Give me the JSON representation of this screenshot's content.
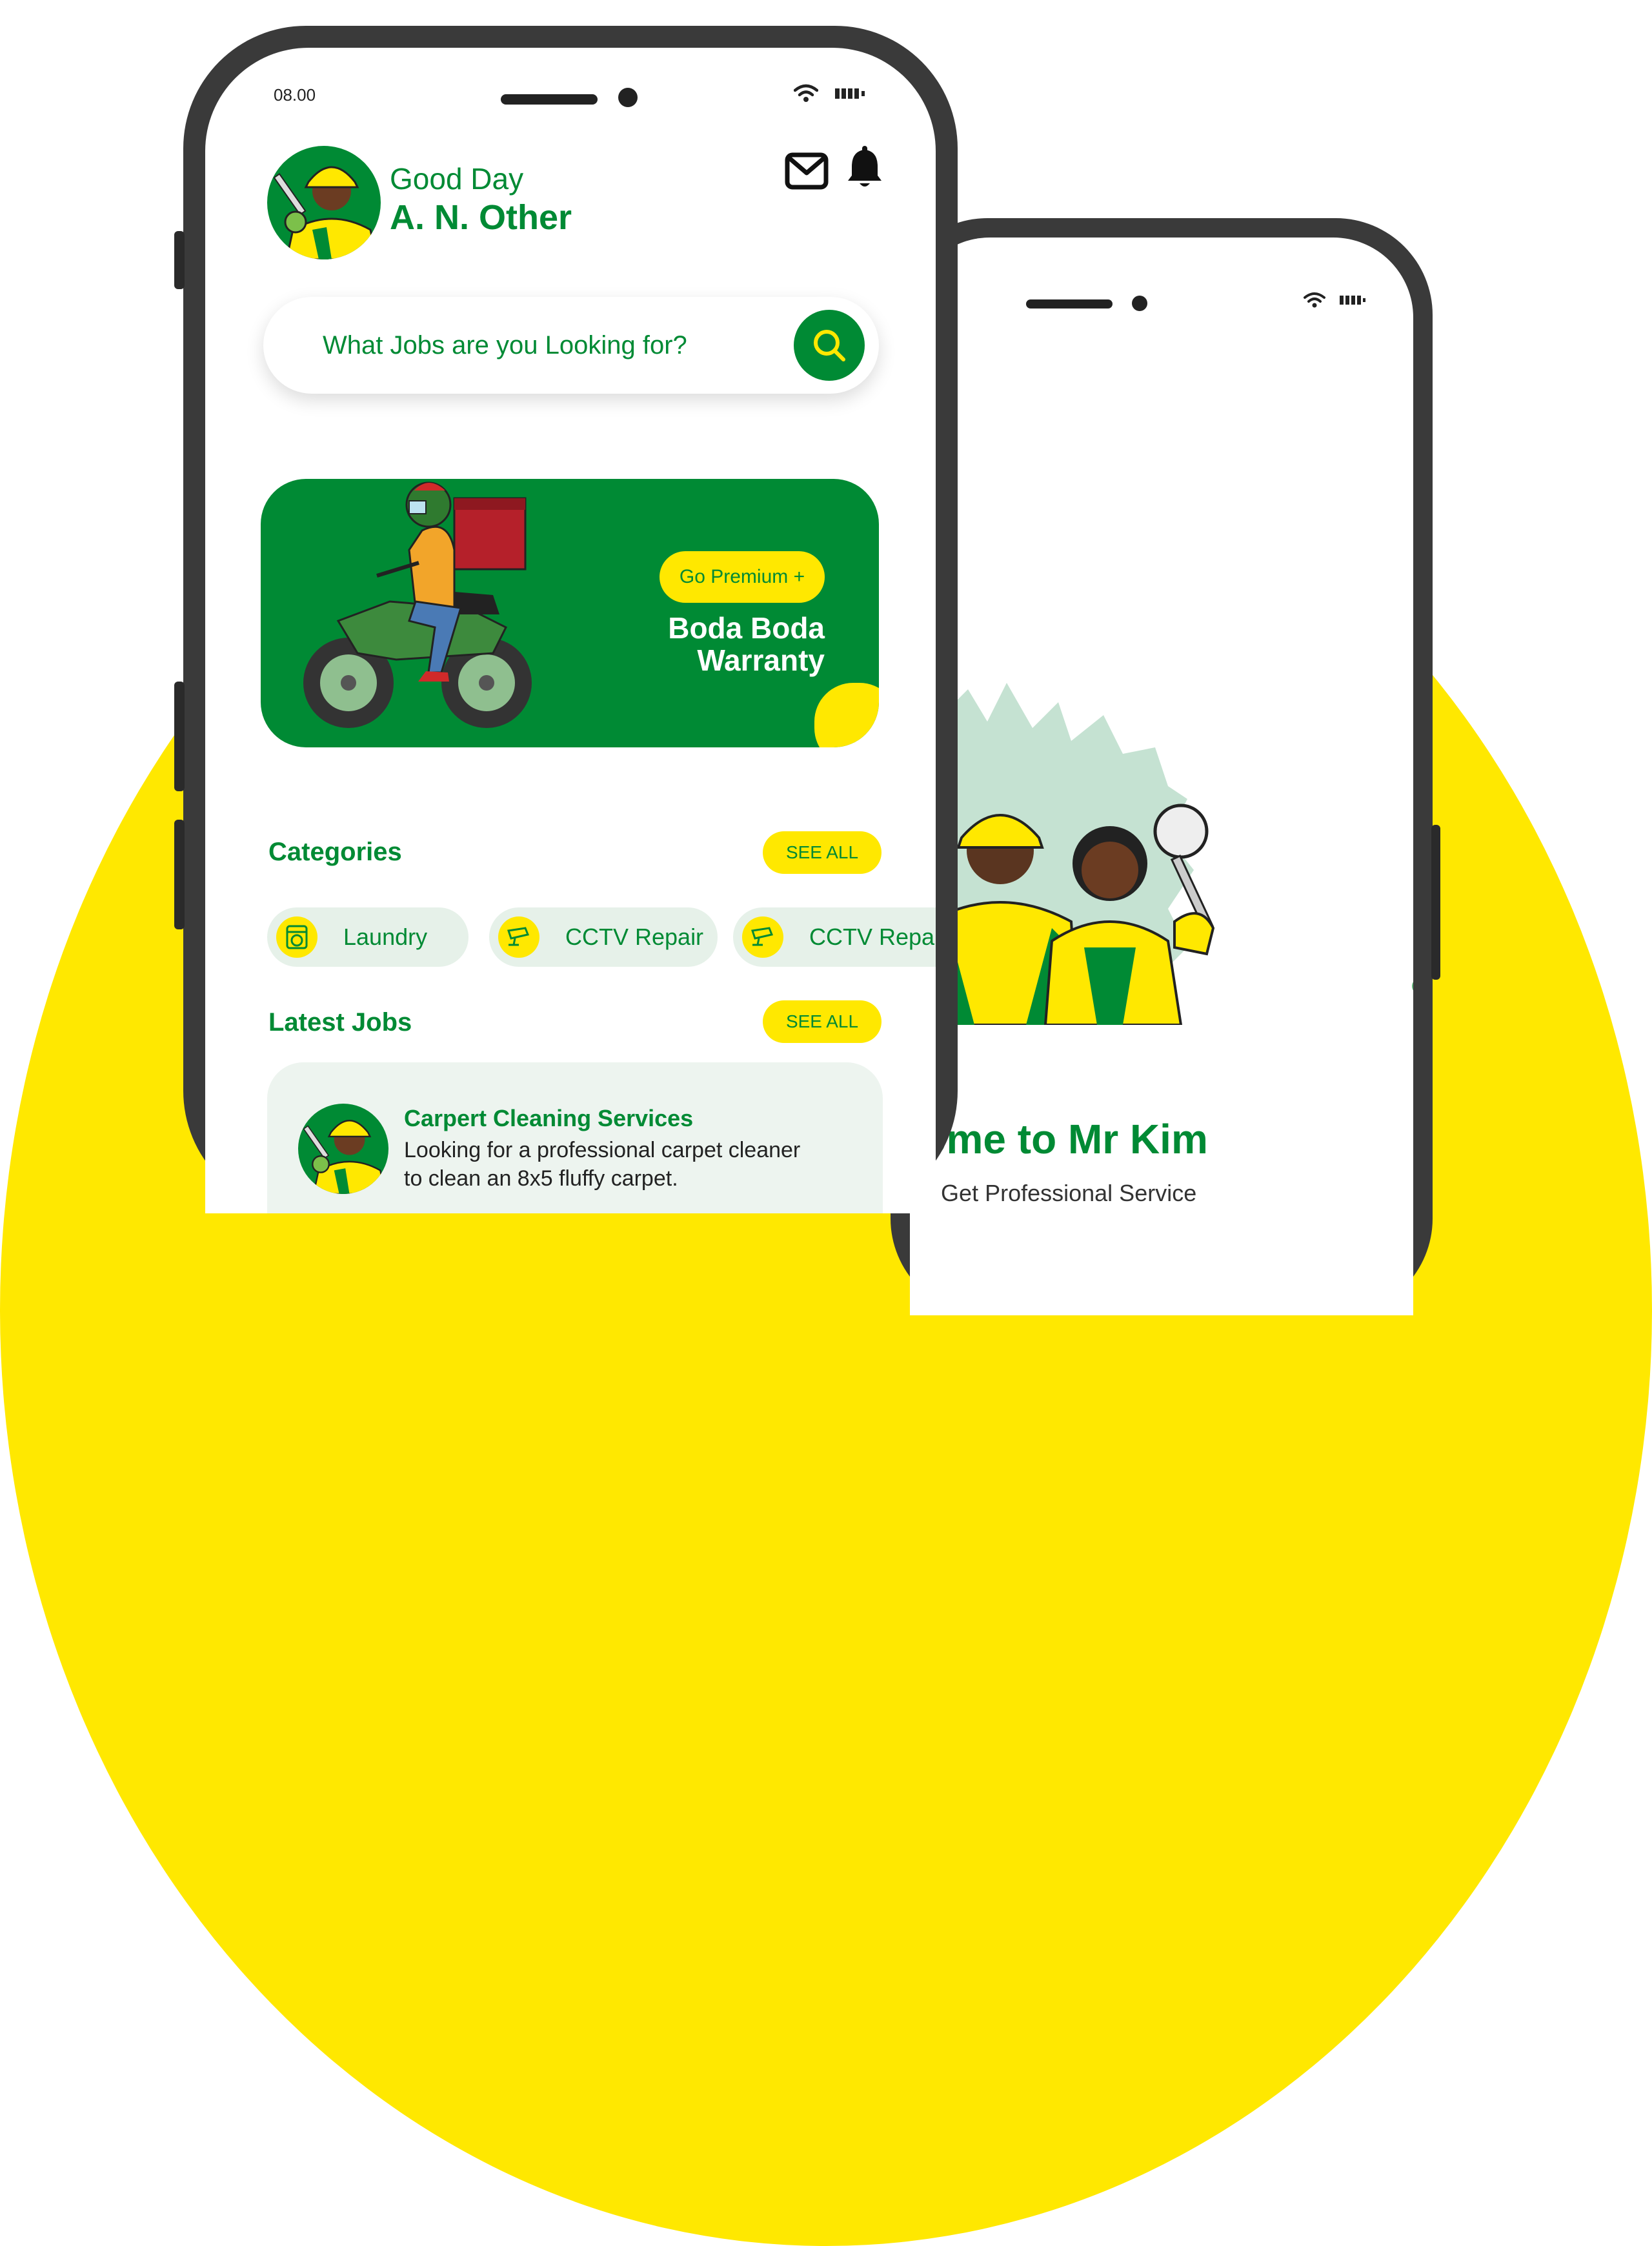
{
  "front_phone": {
    "status": {
      "time": "08.00",
      "icons": [
        "wifi-icon",
        "battery-icon"
      ]
    },
    "header": {
      "greeting": "Good Day",
      "user_name": "A. N. Other",
      "icons": [
        "mail-icon",
        "bell-icon"
      ]
    },
    "search": {
      "placeholder": "What Jobs are you Looking for?",
      "icon": "search-icon"
    },
    "banner": {
      "button_label": "Go Premium +",
      "title_line1": "Boda Boda",
      "title_line2": "Warranty"
    },
    "categories": {
      "title": "Categories",
      "see_all": "SEE ALL",
      "items": [
        {
          "label": "Laundry",
          "icon": "washing-machine-icon"
        },
        {
          "label": "CCTV Repair",
          "icon": "cctv-camera-icon"
        },
        {
          "label": "CCTV Repair",
          "icon": "cctv-camera-icon"
        }
      ]
    },
    "latest_jobs": {
      "title": "Latest Jobs",
      "see_all": "SEE ALL",
      "items": [
        {
          "title": "Carpert Cleaning Services",
          "description": "Looking for a professional carpet cleaner to clean an 8x5 fluffy carpet."
        }
      ]
    }
  },
  "back_phone": {
    "welcome_title": "lcome to Mr Kim",
    "welcome_subtitle": "in to Get Professional Service"
  },
  "colors": {
    "brand_green": "#008A34",
    "brand_yellow": "#FFE800",
    "chip_bg": "#E6F1E9",
    "card_bg": "#EDF4EF"
  }
}
